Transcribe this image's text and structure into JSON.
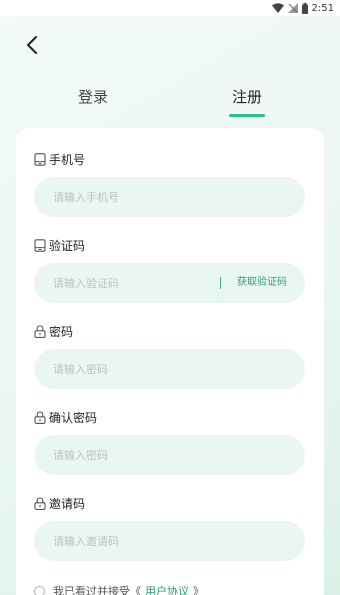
{
  "status_bar": {
    "time": "2:51",
    "icons": [
      "wifi-icon",
      "signal-icon",
      "battery-icon"
    ]
  },
  "nav": {
    "back_icon": "chevron-left-icon"
  },
  "tabs": [
    {
      "label": "登录",
      "active": false
    },
    {
      "label": "注册",
      "active": true
    }
  ],
  "form": {
    "phone": {
      "label": "手机号",
      "icon": "phone-icon",
      "placeholder": "请输入手机号",
      "value": ""
    },
    "code": {
      "label": "验证码",
      "icon": "phone-icon",
      "placeholder": "请输入验证码",
      "value": "",
      "action_label": "获取验证码"
    },
    "password": {
      "label": "密码",
      "icon": "lock-icon",
      "placeholder": "请输入密码",
      "value": ""
    },
    "confirm_password": {
      "label": "确认密码",
      "icon": "lock-icon",
      "placeholder": "请输入密码",
      "value": ""
    },
    "invite_code": {
      "label": "邀请码",
      "icon": "lock-icon",
      "placeholder": "请输入邀请码",
      "value": ""
    }
  },
  "agreement": {
    "prefix": "我已看过并接受《",
    "link": "用户协议",
    "suffix": "》",
    "checked": false
  },
  "colors": {
    "accent": "#2bc08a",
    "input_bg": "#eaf6f3",
    "link": "#2c9f72"
  }
}
